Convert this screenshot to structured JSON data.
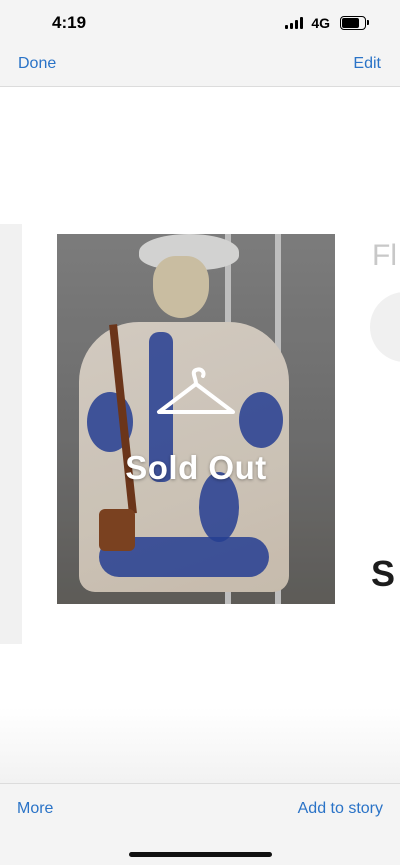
{
  "status_bar": {
    "time": "4:19",
    "network": "4G",
    "signal_icon": "cellular-signal-icon",
    "battery_icon": "battery-icon"
  },
  "nav": {
    "done_label": "Done",
    "edit_label": "Edit"
  },
  "preview": {
    "badge_icon": "hanger-icon",
    "badge_text": "Sold Out",
    "right_title_partial": "Fl",
    "right_letter_partial": "S"
  },
  "toolbar": {
    "more_label": "More",
    "add_to_story_label": "Add to story"
  },
  "colors": {
    "accent": "#2a73c7",
    "bar_background": "#f4f4f4"
  }
}
